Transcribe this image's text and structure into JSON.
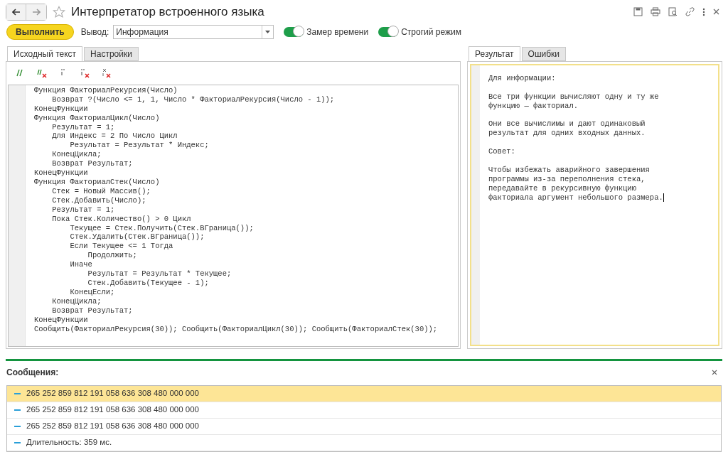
{
  "window": {
    "title": "Интерпретатор встроенного языка"
  },
  "toolbar": {
    "run_button": "Выполнить",
    "output_label": "Вывод:",
    "output_value": "Информация",
    "toggles": [
      {
        "label": "Замер времени",
        "on": true
      },
      {
        "label": "Строгий режим",
        "on": true
      }
    ]
  },
  "left_tabs": [
    {
      "label": "Исходный текст",
      "selected": true
    },
    {
      "label": "Настройки",
      "selected": false
    }
  ],
  "code_lines": [
    "Функция ФакториалРекурсия(Число)",
    "    Возврат ?(Число <= 1, 1, Число * ФакториалРекурсия(Число - 1));",
    "КонецФункции",
    "Функция ФакториалЦикл(Число)",
    "    Результат = 1;",
    "    Для Индекс = 2 По Число Цикл",
    "        Результат = Результат * Индекс;",
    "    КонецЦикла;",
    "    Возврат Результат;",
    "КонецФункции",
    "Функция ФакториалСтек(Число)",
    "    Стек = Новый Массив();",
    "    Стек.Добавить(Число);",
    "    Результат = 1;",
    "    Пока Стек.Количество() > 0 Цикл",
    "        Текущее = Стек.Получить(Стек.ВГраница());",
    "        Стек.Удалить(Стек.ВГраница());",
    "        Если Текущее <= 1 Тогда",
    "            Продолжить;",
    "        Иначе",
    "            Результат = Результат * Текущее;",
    "            Стек.Добавить(Текущее - 1);",
    "        КонецЕсли;",
    "    КонецЦикла;",
    "    Возврат Результат;",
    "КонецФункции",
    "Сообщить(ФакториалРекурсия(30)); Сообщить(ФакториалЦикл(30)); Сообщить(ФакториалСтек(30));"
  ],
  "right_tabs": [
    {
      "label": "Результат",
      "selected": true
    },
    {
      "label": "Ошибки",
      "selected": false
    }
  ],
  "result_paragraphs": [
    [
      "Для информации:"
    ],
    [
      "Все три функции вычисляют одну и ту же",
      "функцию — факториал."
    ],
    [
      "Они все вычислимы и дают одинаковый",
      "результат для одних входных данных."
    ],
    [
      "Совет:"
    ],
    [
      "Чтобы избежать аварийного завершения",
      "программы из-за переполнения стека,",
      "передавайте в рекурсивную функцию",
      "факториала аргумент небольшого размера."
    ]
  ],
  "messages": {
    "title": "Сообщения:",
    "items": [
      {
        "text": "265 252 859 812 191 058 636 308 480 000 000",
        "selected": true
      },
      {
        "text": "265 252 859 812 191 058 636 308 480 000 000",
        "selected": false
      },
      {
        "text": "265 252 859 812 191 058 636 308 480 000 000",
        "selected": false
      },
      {
        "text": "Длительность: 359 мс.",
        "selected": false
      }
    ]
  }
}
